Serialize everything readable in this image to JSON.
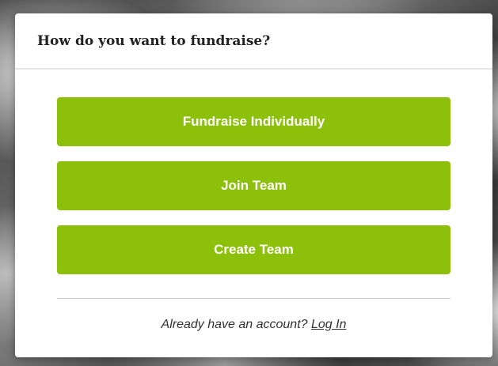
{
  "modal": {
    "title": "How do you want to fundraise?",
    "options": [
      {
        "label": "Fundraise Individually"
      },
      {
        "label": "Join Team"
      },
      {
        "label": "Create Team"
      }
    ],
    "footer": {
      "prompt": "Already have an account?",
      "link_label": "Log In"
    }
  },
  "colors": {
    "accent": "#8cc00b",
    "modal_background": "#ffffff",
    "text": "#222222"
  }
}
